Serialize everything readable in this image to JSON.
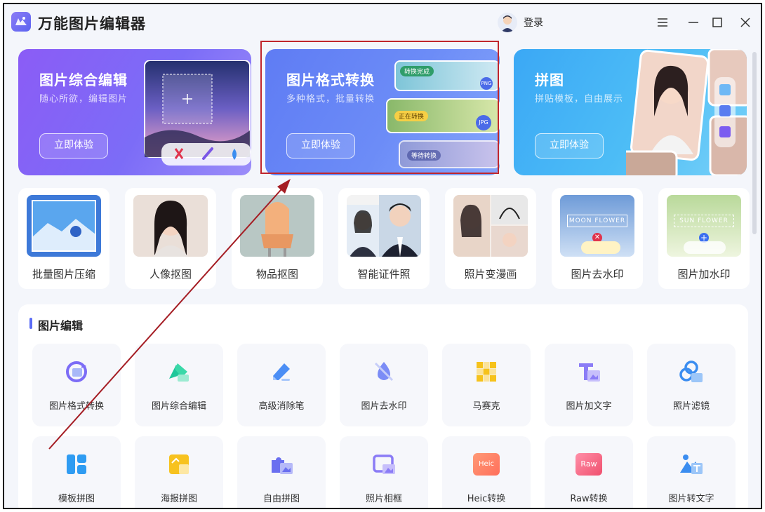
{
  "app": {
    "title": "万能图片编辑器",
    "login_label": "登录"
  },
  "banners": [
    {
      "title": "图片综合编辑",
      "subtitle": "随心所欲，编辑图片",
      "button": "立即体验"
    },
    {
      "title": "图片格式转换",
      "subtitle": "多种格式，批量转换",
      "button": "立即体验",
      "chips": [
        "转换完成",
        "正在转换",
        "等待转换"
      ],
      "formats": [
        "PNG",
        "JPG"
      ]
    },
    {
      "title": "拼图",
      "subtitle": "拼贴模板，自由展示",
      "button": "立即体验"
    }
  ],
  "features": [
    {
      "label": "批量图片压缩"
    },
    {
      "label": "人像抠图"
    },
    {
      "label": "物品抠图"
    },
    {
      "label": "智能证件照"
    },
    {
      "label": "照片变漫画"
    },
    {
      "label": "图片去水印",
      "thumb_text": "MOON FLOWER"
    },
    {
      "label": "图片加水印",
      "thumb_text": "SUN FLOWER"
    }
  ],
  "tools_section": {
    "title": "图片编辑"
  },
  "tools": [
    {
      "label": "图片格式转换",
      "icon": "format-convert-icon"
    },
    {
      "label": "图片综合编辑",
      "icon": "image-edit-icon"
    },
    {
      "label": "高级消除笔",
      "icon": "eraser-pen-icon"
    },
    {
      "label": "图片去水印",
      "icon": "remove-watermark-icon"
    },
    {
      "label": "马赛克",
      "icon": "mosaic-icon"
    },
    {
      "label": "图片加文字",
      "icon": "add-text-icon"
    },
    {
      "label": "照片滤镜",
      "icon": "filter-icon"
    },
    {
      "label": "模板拼图",
      "icon": "template-collage-icon"
    },
    {
      "label": "海报拼图",
      "icon": "poster-collage-icon"
    },
    {
      "label": "自由拼图",
      "icon": "free-collage-icon"
    },
    {
      "label": "照片相框",
      "icon": "photo-frame-icon"
    },
    {
      "label": "Heic转换",
      "icon": "heic-icon",
      "badge": "Heic"
    },
    {
      "label": "Raw转换",
      "icon": "raw-icon",
      "badge": "Raw"
    },
    {
      "label": "图片转文字",
      "icon": "image-to-text-icon"
    }
  ],
  "colors": {
    "accent": "#5b6cf6",
    "highlight": "#c0262d",
    "arrow": "#a51d24"
  }
}
